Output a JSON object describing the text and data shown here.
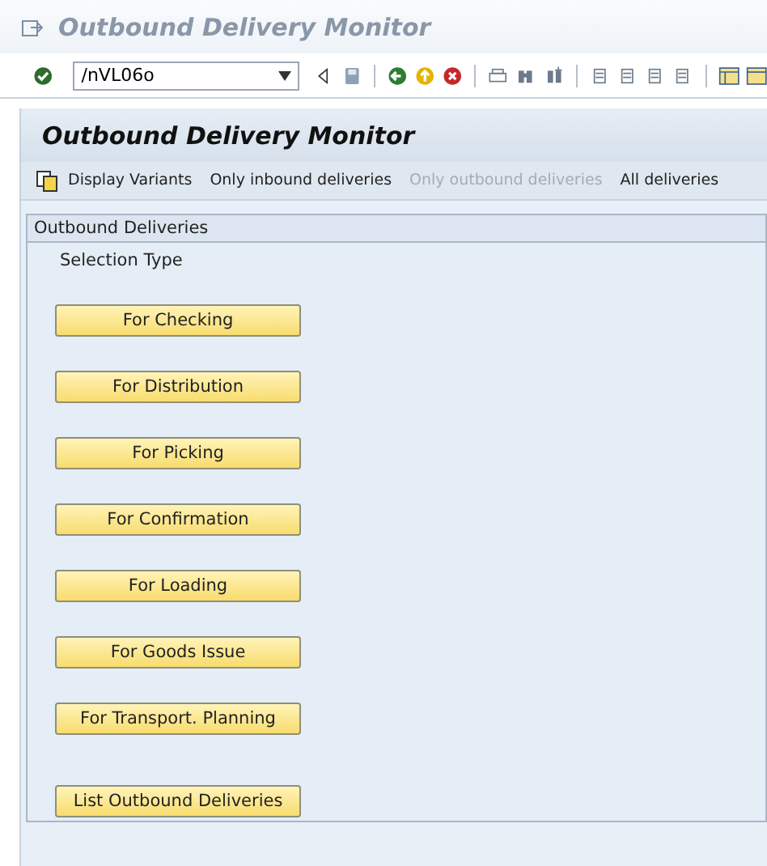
{
  "window": {
    "title": "Outbound Delivery Monitor"
  },
  "command_field": {
    "value": "/nVL06o"
  },
  "screen": {
    "title": "Outbound Delivery Monitor"
  },
  "app_toolbar": [
    {
      "label": "Display Variants",
      "disabled": false,
      "kind": "icon"
    },
    {
      "label": "Only inbound deliveries",
      "disabled": false,
      "kind": "text"
    },
    {
      "label": "Only outbound deliveries",
      "disabled": true,
      "kind": "text"
    },
    {
      "label": "All deliveries",
      "disabled": false,
      "kind": "text"
    }
  ],
  "group": {
    "title": "Outbound Deliveries",
    "label": "Selection Type",
    "buttons": [
      "For Checking",
      "For Distribution",
      "For Picking",
      "For Confirmation",
      "For Loading",
      "For Goods Issue",
      "For Transport. Planning"
    ],
    "list_button": "List Outbound Deliveries"
  }
}
